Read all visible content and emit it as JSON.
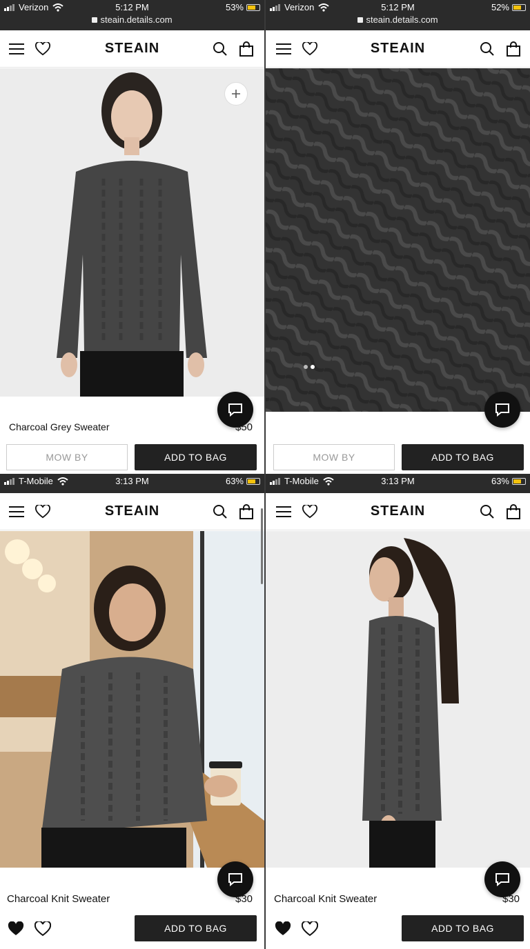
{
  "brand": "STEAIN",
  "panels": [
    {
      "status": {
        "carrier": "Verizon",
        "time": "5:12 PM",
        "battery": "53%",
        "url": "steain.details.com"
      },
      "product": {
        "name": "Charcoal Grey Sweater",
        "price": "$50"
      },
      "buttons": {
        "secondary": "MOW BY",
        "primary": "ADD TO BAG"
      }
    },
    {
      "status": {
        "carrier": "Verizon",
        "time": "5:12 PM",
        "battery": "52%",
        "url": "steain.details.com"
      },
      "product": {
        "name": "",
        "price": ""
      },
      "buttons": {
        "secondary": "MOW BY",
        "primary": "ADD TO BAG"
      }
    },
    {
      "status": {
        "carrier": "T-Mobile",
        "time": "3:13 PM",
        "battery": "63%"
      },
      "product": {
        "name": "Charcoal Knit Sweater",
        "price": "$30"
      },
      "buttons": {
        "primary": "ADD TO BAG"
      }
    },
    {
      "status": {
        "carrier": "T-Mobile",
        "time": "3:13 PM",
        "battery": "63%"
      },
      "product": {
        "name": "Charcoal Knit Sweater",
        "price": "$30"
      },
      "buttons": {
        "primary": "ADD TO BAG"
      }
    }
  ],
  "icons": [
    "menu-icon",
    "heart-icon",
    "search-icon",
    "bag-icon",
    "chat-icon",
    "plus-icon",
    "wifi-icon",
    "battery-icon",
    "lock-icon",
    "heart-filled-icon"
  ],
  "colors": {
    "dark": "#222222",
    "statusbar": "#2b2b2b",
    "battery": "#f4c20d",
    "border": "#e5e5e5"
  }
}
